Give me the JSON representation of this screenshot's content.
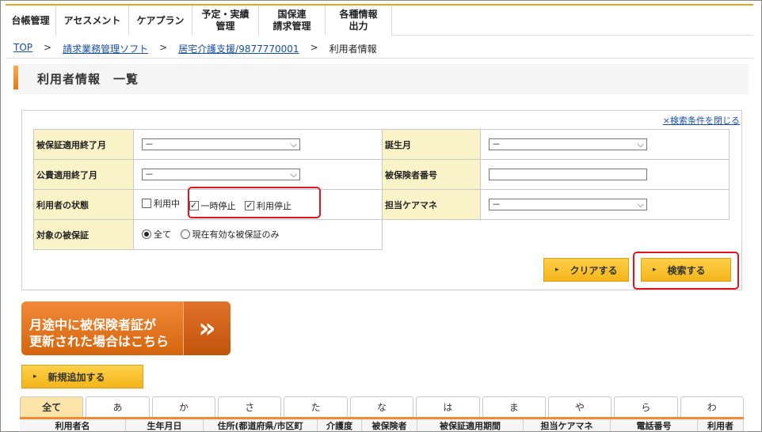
{
  "nav": [
    {
      "label": "台帳管理"
    },
    {
      "label": "アセスメント"
    },
    {
      "label": "ケアプラン"
    },
    {
      "label": "予定・実績\n管理"
    },
    {
      "label": "国保連\n請求管理"
    },
    {
      "label": "各種情報\n出力"
    }
  ],
  "breadcrumb": {
    "top": "TOP",
    "sep": ">",
    "software": "請求業務管理ソフト",
    "office": "居宅介護支援/9877770001",
    "current": "利用者情報"
  },
  "page_title": "利用者情報　一覧",
  "search": {
    "close_link": "×検索条件を閉じる",
    "rows": {
      "insured_end_month": {
        "label": "被保証適用終了月",
        "value": "－"
      },
      "birth_month": {
        "label": "誕生月",
        "value": "－"
      },
      "public_end_month": {
        "label": "公費適用終了月",
        "value": "－"
      },
      "insured_number": {
        "label": "被保険者番号",
        "value": ""
      },
      "user_status": {
        "label": "利用者の状態",
        "options": [
          {
            "label": "利用中",
            "checked": false
          },
          {
            "label": "一時停止",
            "checked": true
          },
          {
            "label": "利用停止",
            "checked": true
          }
        ]
      },
      "care_manager": {
        "label": "担当ケアマネ",
        "value": "－"
      },
      "target_card": {
        "label": "対象の被保証",
        "options": [
          {
            "label": "全て",
            "selected": true
          },
          {
            "label": "現在有効な被保証のみ",
            "selected": false
          }
        ]
      }
    },
    "clear_button": "クリアする",
    "search_button": "検索する"
  },
  "banner": {
    "line1": "月途中に被保険者証が",
    "line2": "更新された場合はこちら",
    "arrows": "»"
  },
  "add_button": "新規追加する",
  "kana_tabs": [
    "全て",
    "あ",
    "か",
    "さ",
    "た",
    "な",
    "は",
    "ま",
    "や",
    "ら",
    "わ"
  ],
  "active_tab": "全て",
  "table_headers": [
    "利用者名",
    "生年月日",
    "住所(都道府県/市区町",
    "介護度",
    "被保険者",
    "被保証適用期間",
    "担当ケアマネ",
    "電話番号",
    "利用者"
  ],
  "colors": {
    "accent": "#f08a38",
    "highlight": "#e0141e",
    "button": "#f3b51a",
    "link": "#1a4fa0"
  }
}
